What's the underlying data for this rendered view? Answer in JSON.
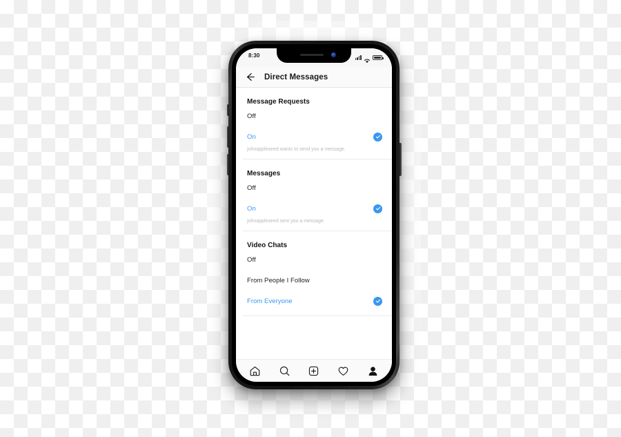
{
  "device": {
    "status_bar": {
      "time": "8:30",
      "signal_icon": "signal-bars-icon",
      "wifi_icon": "wifi-icon",
      "battery_icon": "battery-icon"
    }
  },
  "header": {
    "back_icon": "back-arrow-icon",
    "title": "Direct Messages"
  },
  "colors": {
    "accent": "#3897f0",
    "text_primary": "#1d1d1d",
    "text_muted": "#b8b8b8",
    "divider": "#e9e9e9"
  },
  "sections": [
    {
      "title": "Message Requests",
      "options": [
        {
          "label": "Off",
          "selected": false
        },
        {
          "label": "On",
          "selected": true
        }
      ],
      "subtitle": "johnappleseed wants to send you a message."
    },
    {
      "title": "Messages",
      "options": [
        {
          "label": "Off",
          "selected": false
        },
        {
          "label": "On",
          "selected": true
        }
      ],
      "subtitle": "johnappleseed sent you a message."
    },
    {
      "title": "Video Chats",
      "options": [
        {
          "label": "Off",
          "selected": false
        },
        {
          "label": "From People I Follow",
          "selected": false
        },
        {
          "label": "From Everyone",
          "selected": true
        }
      ],
      "subtitle": ""
    }
  ],
  "bottom_nav": [
    {
      "icon": "home-icon",
      "label": "Home",
      "active": false
    },
    {
      "icon": "search-icon",
      "label": "Search",
      "active": false
    },
    {
      "icon": "add-post-icon",
      "label": "New Post",
      "active": false
    },
    {
      "icon": "heart-icon",
      "label": "Activity",
      "active": false
    },
    {
      "icon": "profile-icon",
      "label": "Profile",
      "active": true
    }
  ]
}
